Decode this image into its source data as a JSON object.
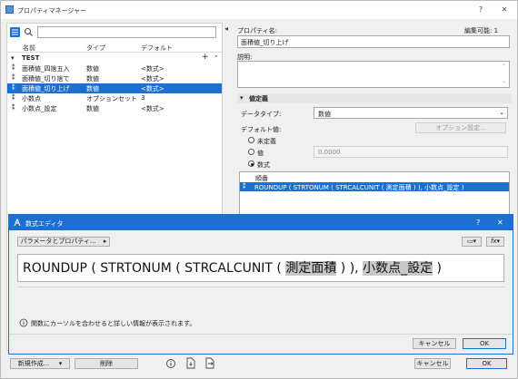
{
  "window": {
    "title": "プロパティマネージャー",
    "help": "?",
    "close": "✕"
  },
  "left": {
    "filter_value": "",
    "columns": [
      "名前",
      "タイプ",
      "デフォルト"
    ],
    "group": "TEST",
    "rows": [
      {
        "name": "面積値_四捨五入",
        "type": "数値",
        "default": "<数式>",
        "selected": false
      },
      {
        "name": "面積値_切り捨て",
        "type": "数値",
        "default": "<数式>",
        "selected": false
      },
      {
        "name": "面積値_切り上げ",
        "type": "数値",
        "default": "<数式>",
        "selected": true
      },
      {
        "name": "小数点",
        "type": "オプションセット",
        "default": "3",
        "selected": false
      },
      {
        "name": "小数点_設定",
        "type": "数値",
        "default": "<数式>",
        "selected": false
      }
    ],
    "new_button": "新規作成...",
    "delete_button": "削除"
  },
  "right": {
    "property_name_label": "プロパティ名:",
    "editable_label": "編集可能: 1",
    "property_name_value": "面積値_切り上げ",
    "description_label": "説明:",
    "description_value": "",
    "section_title": "値定義",
    "datatype_label": "データタイプ:",
    "datatype_value": "数値",
    "default_label": "デフォルト値:",
    "option_button": "オプション設定...",
    "radio_undefined": "未定義",
    "radio_value": "値",
    "value_field": "0.0000",
    "radio_formula": "数式",
    "condition_header": "順番",
    "condition_row": "ROUNDUP ( STRTONUM ( STRCALCUNIT ( 測定面積 ) ), 小数点_設定 )",
    "cancel_button": "キャンセル",
    "ok_button": "OK"
  },
  "dialog": {
    "title": "数式エディタ",
    "help": "?",
    "close": "✕",
    "params_button": "パラメータとプロパティ...",
    "expr_part1": "ROUNDUP ( STRTONUM ( STRCALCUNIT ( ",
    "expr_token1": "測定面積",
    "expr_part2": " ) ), ",
    "expr_token2": "小数点_設定",
    "expr_part3": " )",
    "hint": "関数にカーソルを合わせると詳しい情報が表示されます。",
    "cancel_button": "キャンセル",
    "ok_button": "OK",
    "fx_label": "fx"
  }
}
